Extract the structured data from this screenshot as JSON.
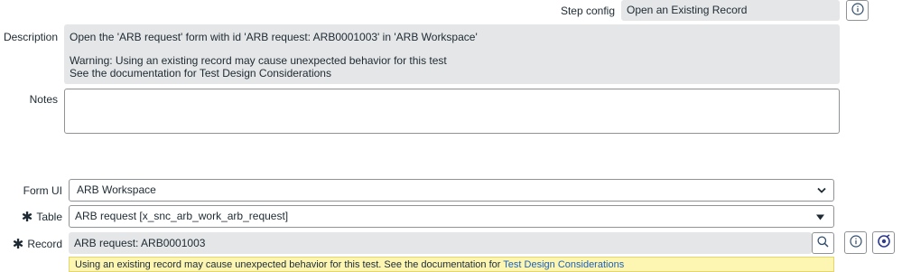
{
  "step_config": {
    "label": "Step config",
    "value": "Open an Existing Record"
  },
  "description": {
    "label": "Description",
    "line1": "Open the 'ARB request' form with id 'ARB request: ARB0001003' in 'ARB Workspace'",
    "line2": "Warning: Using an existing record may cause unexpected behavior for this test",
    "line3": "See the documentation for Test Design Considerations"
  },
  "notes": {
    "label": "Notes",
    "value": ""
  },
  "form_ui": {
    "label": "Form UI",
    "value": "ARB Workspace"
  },
  "table": {
    "label": "Table",
    "value": "ARB request [x_snc_arb_work_arb_request]"
  },
  "record": {
    "label": "Record",
    "value": "ARB request: ARB0001003"
  },
  "warning": {
    "text": "Using an existing record may cause unexpected behavior for this test. See the documentation for ",
    "link": "Test Design Considerations"
  },
  "colors": {
    "link": "#1f5fb3",
    "warning_bg": "#fdf6b2",
    "readonly_bg": "#e4e6e7",
    "accent_icon": "#2f3b8f"
  },
  "icons": [
    "info-icon",
    "search-icon",
    "info-icon",
    "preview-record-icon",
    "chevron-down-icon",
    "caret-down-icon",
    "required-asterisk-icon"
  ]
}
